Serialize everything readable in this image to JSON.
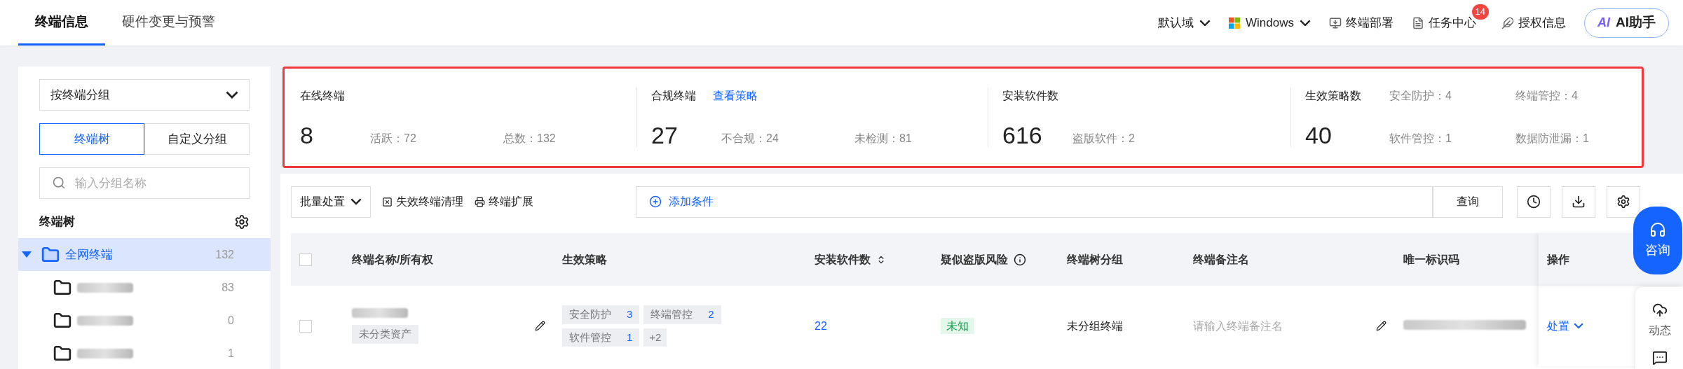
{
  "tabs": [
    {
      "label": "终端信息",
      "selected": true
    },
    {
      "label": "硬件变更与预警",
      "selected": false
    }
  ],
  "header": {
    "domain": "默认域",
    "os": "Windows",
    "deploy": "终端部署",
    "tasks": {
      "label": "任务中心",
      "badge": "14"
    },
    "license": "授权信息",
    "ai_icon": "AI",
    "ai_button": "AI助手"
  },
  "sidebar": {
    "group_select": "按终端分组",
    "view_tabs": [
      {
        "label": "终端树",
        "selected": true
      },
      {
        "label": "自定义分组",
        "selected": false
      }
    ],
    "search": {
      "placeholder": "输入分组名称"
    },
    "tree_title": "终端树",
    "tree": [
      {
        "label": "全网终端",
        "count": "132",
        "expanded": true,
        "selected": true,
        "children": [
          {
            "count": "83",
            "selected": false
          },
          {
            "count": "0",
            "selected": false
          },
          {
            "count": "1",
            "selected": false
          }
        ]
      }
    ]
  },
  "stats": [
    {
      "kind": "row",
      "title": "在线终端",
      "value": "8",
      "details": [
        "活跃：72",
        "总数：132"
      ]
    },
    {
      "kind": "row",
      "title": "合规终端",
      "link": "查看策略",
      "value": "27",
      "details": [
        "不合规：24",
        "未检测：81"
      ]
    },
    {
      "kind": "row",
      "title": "安装软件数",
      "value": "616",
      "details": [
        "盗版软件：2"
      ]
    },
    {
      "kind": "grid",
      "title": "生效策略数",
      "value": "40",
      "details": [
        "安全防护：4",
        "终端管控：4",
        "软件管控：1",
        "数据防泄漏：1"
      ]
    }
  ],
  "toolbar": {
    "batch": "批量处置",
    "actions": [
      {
        "kind": "cleanup",
        "label": "失效终端清理"
      },
      {
        "kind": "extend",
        "label": "终端扩展"
      }
    ],
    "add_condition": "添加条件",
    "query": "查询"
  },
  "table": {
    "columns": [
      {
        "kind": "check",
        "checked": false
      },
      {
        "kind": "plain",
        "label": "终端名称/所有权"
      },
      {
        "kind": "plain",
        "label": "生效策略"
      },
      {
        "kind": "sort",
        "label": "安装软件数"
      },
      {
        "kind": "info",
        "label": "疑似盗版风险"
      },
      {
        "kind": "plain",
        "label": "终端树分组"
      },
      {
        "kind": "plain",
        "label": "终端备注名"
      },
      {
        "kind": "plain",
        "label": "唯一标识码"
      },
      {
        "kind": "plain",
        "label": "操作"
      }
    ],
    "rows": [
      {
        "checked": false,
        "owner_tag": "未分类资产",
        "policies": [
          {
            "label": "安全防护",
            "count": "3"
          },
          {
            "label": "终端管控",
            "count": "2"
          },
          {
            "label": "软件管控",
            "count": "1"
          }
        ],
        "policies_more": "+2",
        "software_count": "22",
        "risk": "未知",
        "group": "未分组终端",
        "note_placeholder": "请输入终端备注名",
        "action": "处置"
      }
    ]
  },
  "floating": {
    "consult": "咨询",
    "activity": "动态"
  }
}
